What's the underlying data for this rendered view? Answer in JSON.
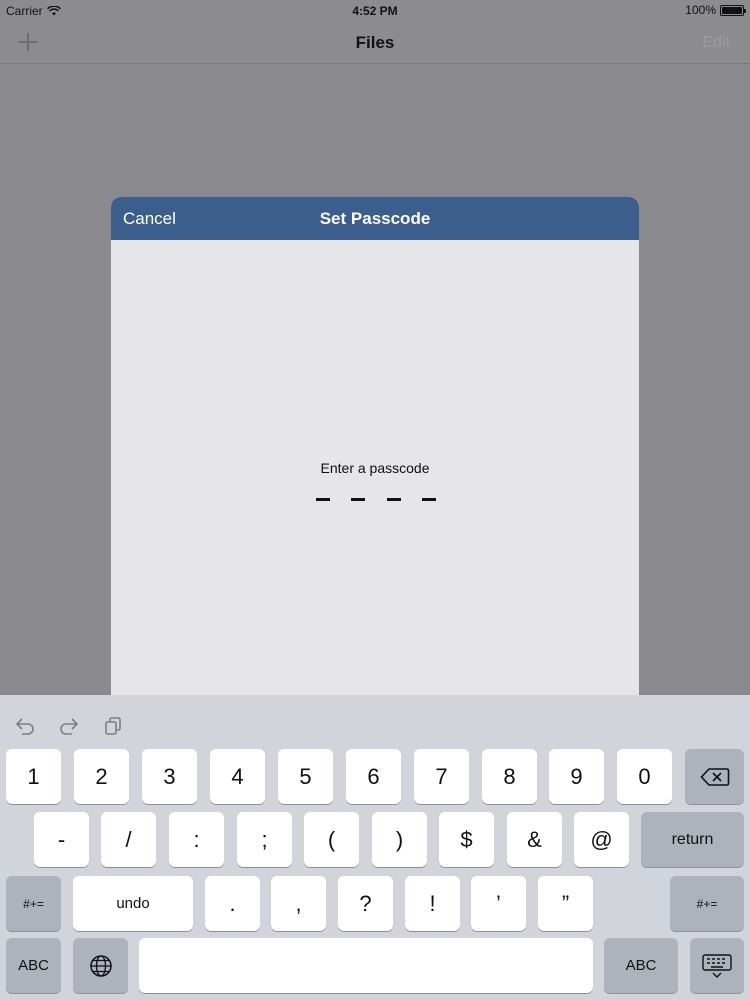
{
  "status_bar": {
    "carrier": "Carrier",
    "time": "4:52 PM",
    "battery": "100%",
    "battery_level": 1.0
  },
  "nav_bar": {
    "title": "Files",
    "add_icon": "plus-icon",
    "edit_label": "Edit"
  },
  "modal": {
    "cancel_label": "Cancel",
    "title": "Set Passcode",
    "prompt": "Enter a passcode",
    "digit_slots": 4,
    "header_color": "#3b5e8c"
  },
  "keyboard": {
    "shortcuts": [
      "undo-icon",
      "redo-icon",
      "paste-icon"
    ],
    "row1": [
      "1",
      "2",
      "3",
      "4",
      "5",
      "6",
      "7",
      "8",
      "9",
      "0"
    ],
    "row1_delete_icon": "backspace-icon",
    "row2": [
      "-",
      "/",
      ":",
      ";",
      "(",
      ")",
      "$",
      "&",
      "@"
    ],
    "row2_return": "return",
    "row3_left_toggle": "#+=",
    "row3_undo": "undo",
    "row3": [
      ".",
      ",",
      "?",
      "!",
      "’",
      "”"
    ],
    "row3_right_toggle": "#+=",
    "row4_left_abc": "ABC",
    "row4_globe_icon": "globe-icon",
    "row4_right_abc": "ABC",
    "row4_hide_icon": "keyboard-dismiss-icon"
  }
}
